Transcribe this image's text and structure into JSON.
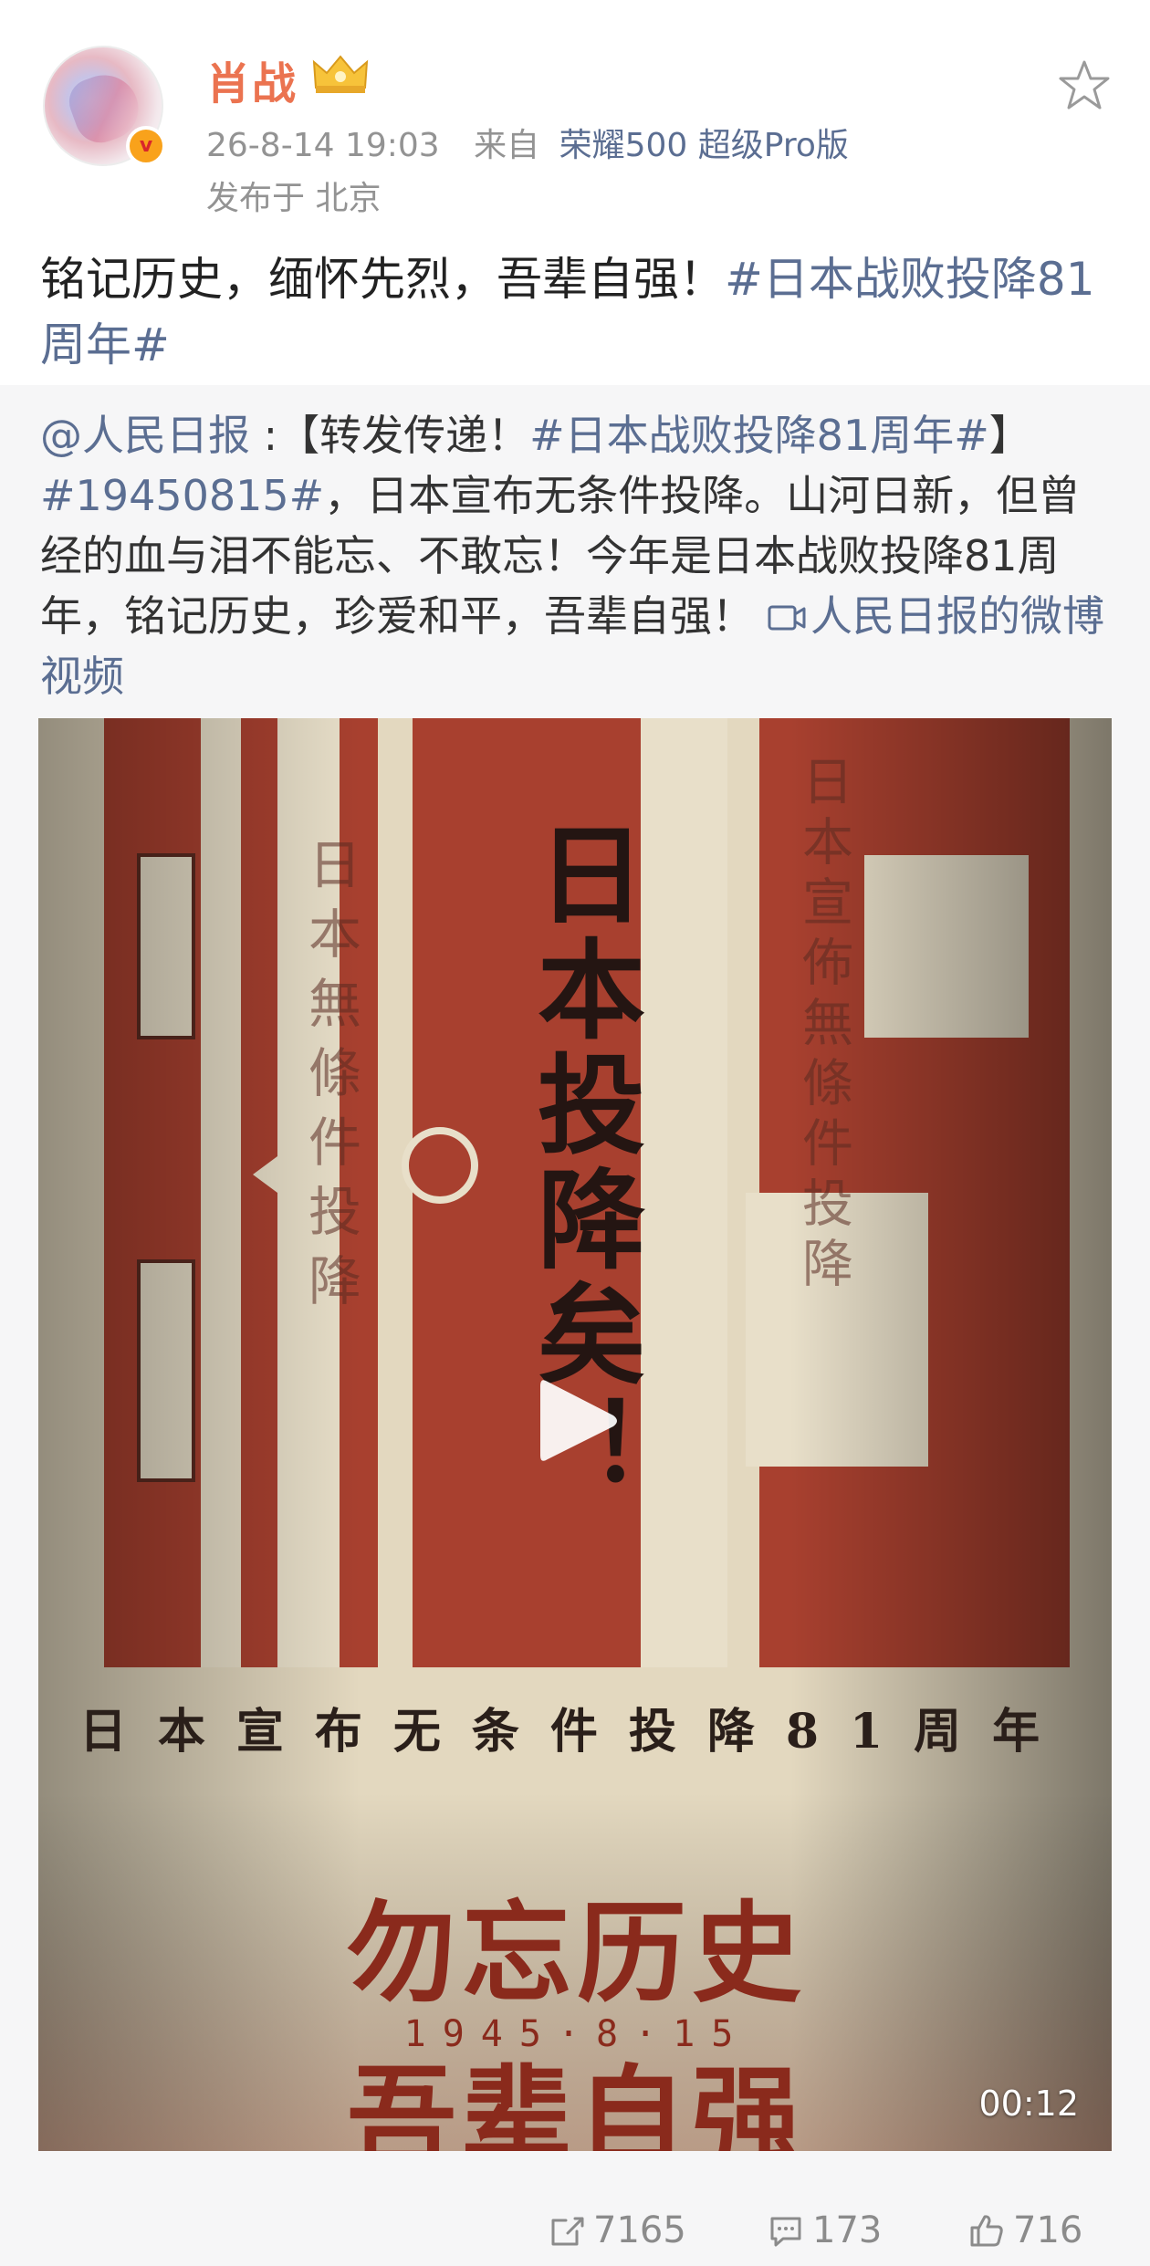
{
  "user": {
    "name": "肖战",
    "timestamp": "26-8-14 19:03",
    "from_label": "来自",
    "device": "荣耀500 超级Pro版",
    "location": "发布于 北京",
    "verified_badge": "v"
  },
  "post": {
    "text": "铭记历史，缅怀先烈，吾辈自强！",
    "topic": "#日本战败投降81周年#"
  },
  "repost": {
    "author": "@人民日报",
    "sep": " :【转发传递！",
    "topic1": "#日本战败投降81周年#",
    "bracket_close": "】",
    "topic2": "#19450815#",
    "body": "，日本宣布无条件投降。山河日新，但曾经的血与泪不能忘、不敢忘！今年是日本战败投降81周年，铭记历史，珍爱和平，吾辈自强！",
    "video_link": "人民日报的微博视频"
  },
  "video": {
    "poster": {
      "vertical_title": "日本投降矣！",
      "subtitle": "日本宣布无条件投降81周年",
      "slogan1": "勿忘历史",
      "date": "1945·8·15",
      "slogan2": "吾辈自强",
      "left_column_text": "日本無條件投降",
      "right_column_text": "日本宣佈無條件投降"
    },
    "duration": "00:12"
  },
  "actions": {
    "forward_count": "7165",
    "comment_count": "173",
    "like_count": "716"
  },
  "colors": {
    "name": "#eb7350",
    "link": "#5b6e92",
    "muted": "#939393",
    "poster_red": "#a8402f",
    "poster_cream": "#e8dfc9"
  },
  "icons": {
    "star": "star-outline-icon",
    "crown": "crown-badge-icon",
    "forward": "forward-icon",
    "comment": "comment-icon",
    "like": "thumb-up-icon",
    "play": "play-icon",
    "video_link": "video-link-icon"
  }
}
